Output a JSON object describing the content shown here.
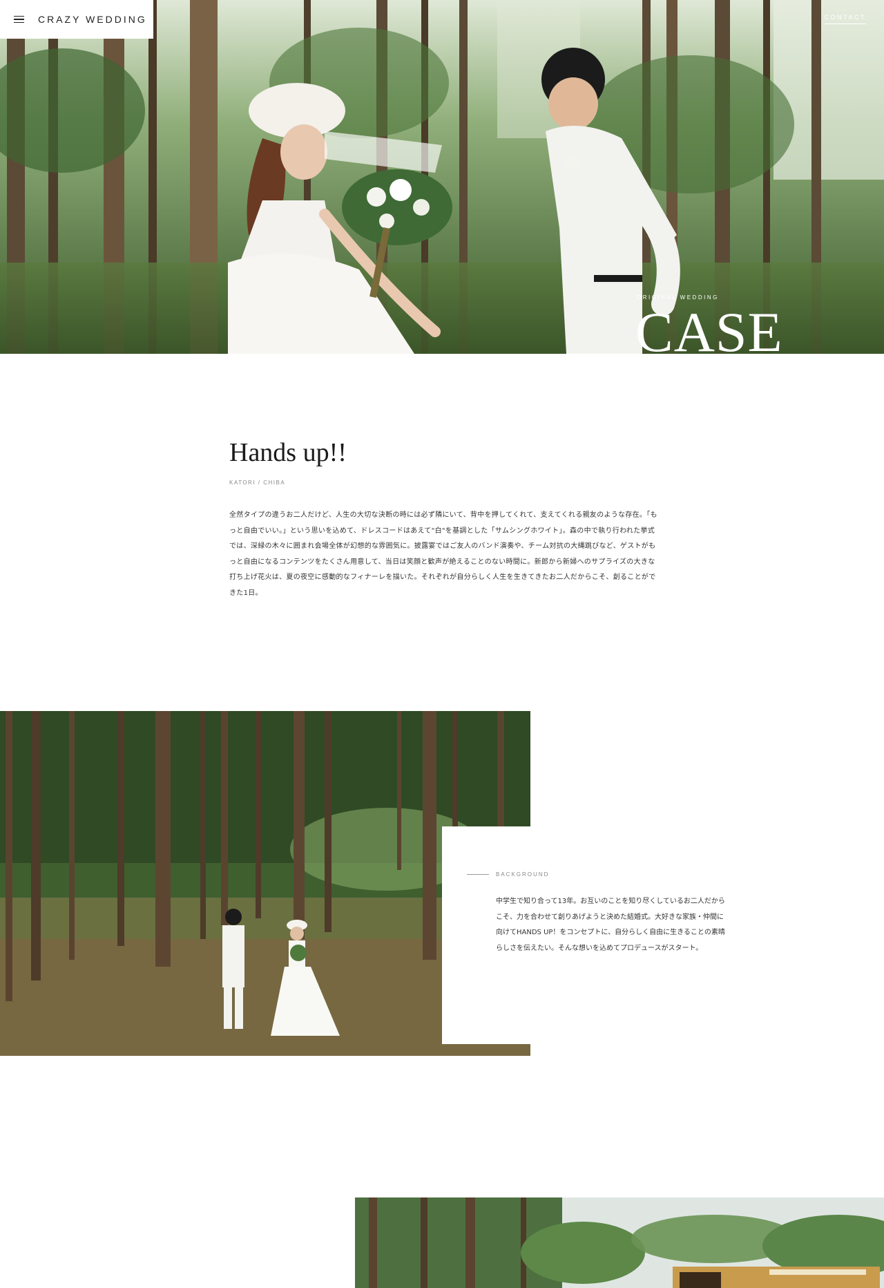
{
  "header": {
    "menu_icon": "hamburger-menu-icon",
    "brand": "CRAZY WEDDING",
    "contact": "CONTACT"
  },
  "hero": {
    "kicker": "ORIGINAL WEDDING",
    "title": "CASE"
  },
  "intro": {
    "title": "Hands up!!",
    "location": "KATORI / CHIBA",
    "body": "全然タイプの違うお二人だけど、人生の大切な決断の時には必ず隣にいて、背中を押してくれて、支えてくれる親友のような存在。「もっと自由でいい。」という思いを込めて、ドレスコードはあえて\"白\"を基調とした「サムシングホワイト」。森の中で執り行われた挙式では、深緑の木々に囲まれ会場全体が幻想的な雰囲気に。披露宴ではご友人のバンド演奏や、チーム対抗の大縄跳びなど、ゲストがもっと自由になるコンテンツをたくさん用意して、当日は笑顔と歓声が絶えることのない時間に。新郎から新婦へのサプライズの大きな打ち上げ花火は、夏の夜空に感動的なフィナーレを描いた。それぞれが自分らしく人生を生きてきたお二人だからこそ、創ることができた1日。"
  },
  "background_section": {
    "label": "BACKGROUND",
    "text": "中学生で知り合って13年。お互いのことを知り尽くしているお二人だからこそ、力を合わせて創りあげようと決めた結婚式。大好きな家族・仲間に向けてHANDS UP！をコンセプトに、自分らしく自由に生きることの素晴らしさを伝えたい。そんな想いを込めてプロデュースがスタート。"
  },
  "colors": {
    "background": "#ffffff",
    "text": "#222222",
    "muted": "#888888",
    "forest_green": "#3b5a2b"
  }
}
